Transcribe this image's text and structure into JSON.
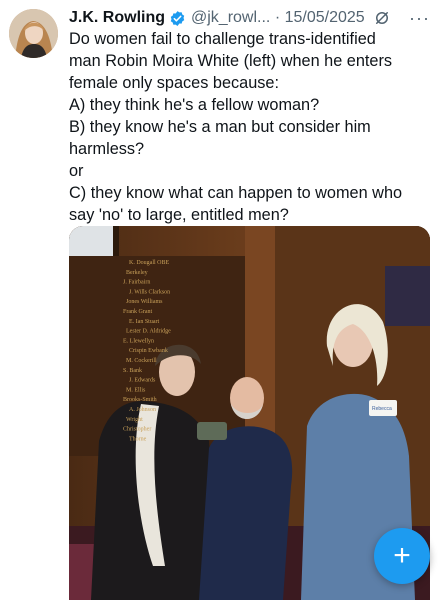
{
  "tweet": {
    "author_name": "J.K. Rowling",
    "handle_date": "@jk_rowl... · 15/05/2025",
    "more_label": "···",
    "text_lines": [
      "Do women fail to challenge trans-identified",
      "man Robin Moira White (left) when he enters",
      "female only spaces because:",
      "A) they think he's a fellow woman?",
      "B) they know he's a man but consider him",
      "harmless?",
      "or",
      "C) they know what can happen to women who",
      "say 'no' to large, entitled men?"
    ]
  },
  "media": {
    "board_text": [
      "K. Dougall OBE",
      "Berkeley",
      "J. Fairbairn",
      "J. Wills Clarkson",
      "Jones Williams",
      "Frank Grant",
      "E. Ian Stuart",
      "Lester D. Aldridge",
      "E. Llewellyn",
      "Crispin Ewbank",
      "M. Cockerill",
      "S. Bank",
      "J. Edwards",
      "M. Ellis",
      "Brooks-Smith",
      "A. Johnson",
      "Wright",
      "Christopher",
      "Thorne"
    ],
    "badge_text": "Rebecca"
  },
  "fab": {
    "icon": "plus-icon",
    "label": "+"
  },
  "colors": {
    "accent": "#1d9bf0",
    "text": "#0f1419",
    "muted": "#536471"
  }
}
